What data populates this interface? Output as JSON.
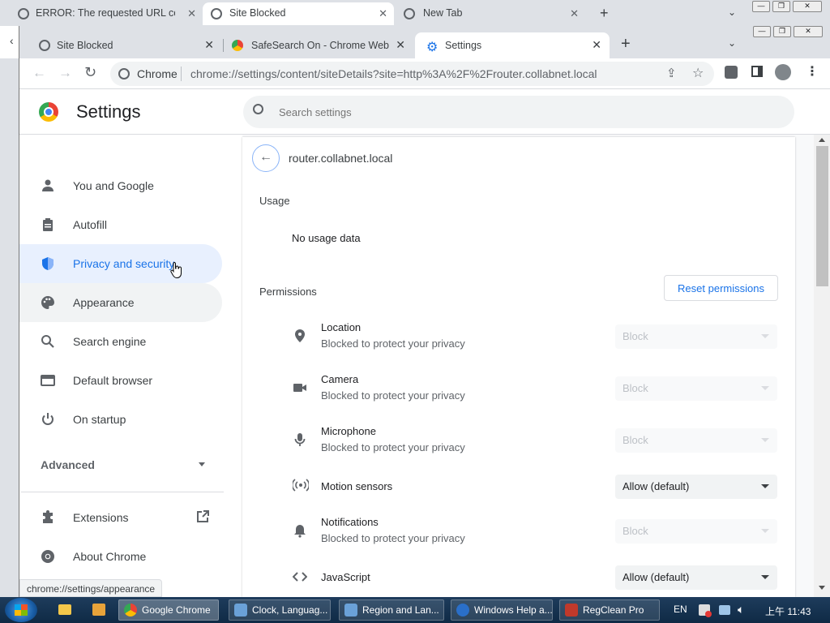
{
  "back_window": {
    "tabs": [
      {
        "title": "ERROR: The requested URL could"
      },
      {
        "title": "Site Blocked"
      },
      {
        "title": "New Tab"
      }
    ]
  },
  "front_window": {
    "tabs": [
      {
        "title": "Site Blocked"
      },
      {
        "title": "SafeSearch On - Chrome Web Store"
      },
      {
        "title": "Settings"
      }
    ],
    "omnibox": {
      "chip": "Chrome",
      "url": "chrome://settings/content/siteDetails?site=http%3A%2F%2Frouter.collabnet.local"
    }
  },
  "settings": {
    "title": "Settings",
    "search_placeholder": "Search settings",
    "sidebar": {
      "items": [
        {
          "label": "You and Google",
          "icon": "person-icon"
        },
        {
          "label": "Autofill",
          "icon": "clipboard-icon"
        },
        {
          "label": "Privacy and security",
          "icon": "shield-icon",
          "selected": true
        },
        {
          "label": "Appearance",
          "icon": "palette-icon",
          "hovered": true
        },
        {
          "label": "Search engine",
          "icon": "search-icon"
        },
        {
          "label": "Default browser",
          "icon": "browser-icon"
        },
        {
          "label": "On startup",
          "icon": "power-icon"
        }
      ],
      "advanced": "Advanced",
      "extensions": "Extensions",
      "about": "About Chrome"
    },
    "site": {
      "name": "router.collabnet.local",
      "usage_heading": "Usage",
      "usage_text": "No usage data",
      "permissions_heading": "Permissions",
      "reset_label": "Reset permissions",
      "permissions": [
        {
          "name": "Location",
          "desc": "Blocked to protect your privacy",
          "value": "Block",
          "disabled": true,
          "icon": "location-icon"
        },
        {
          "name": "Camera",
          "desc": "Blocked to protect your privacy",
          "value": "Block",
          "disabled": true,
          "icon": "camera-icon"
        },
        {
          "name": "Microphone",
          "desc": "Blocked to protect your privacy",
          "value": "Block",
          "disabled": true,
          "icon": "microphone-icon"
        },
        {
          "name": "Motion sensors",
          "desc": "",
          "value": "Allow (default)",
          "disabled": false,
          "icon": "sensors-icon"
        },
        {
          "name": "Notifications",
          "desc": "Blocked to protect your privacy",
          "value": "Block",
          "disabled": true,
          "icon": "bell-icon"
        },
        {
          "name": "JavaScript",
          "desc": "",
          "value": "Allow (default)",
          "disabled": false,
          "icon": "code-icon"
        }
      ]
    },
    "status_url": "chrome://settings/appearance"
  },
  "taskbar": {
    "items": [
      {
        "label": "Google Chrome",
        "active": true
      },
      {
        "label": "Clock, Languag..."
      },
      {
        "label": "Region and Lan..."
      },
      {
        "label": "Windows Help a..."
      },
      {
        "label": "RegClean Pro"
      }
    ],
    "lang": "EN",
    "clock": "上午 11:43"
  },
  "colors": {
    "accent": "#1a73e8",
    "selected_bg": "#e8f0fe",
    "taskbar": "#1e3c5c"
  }
}
